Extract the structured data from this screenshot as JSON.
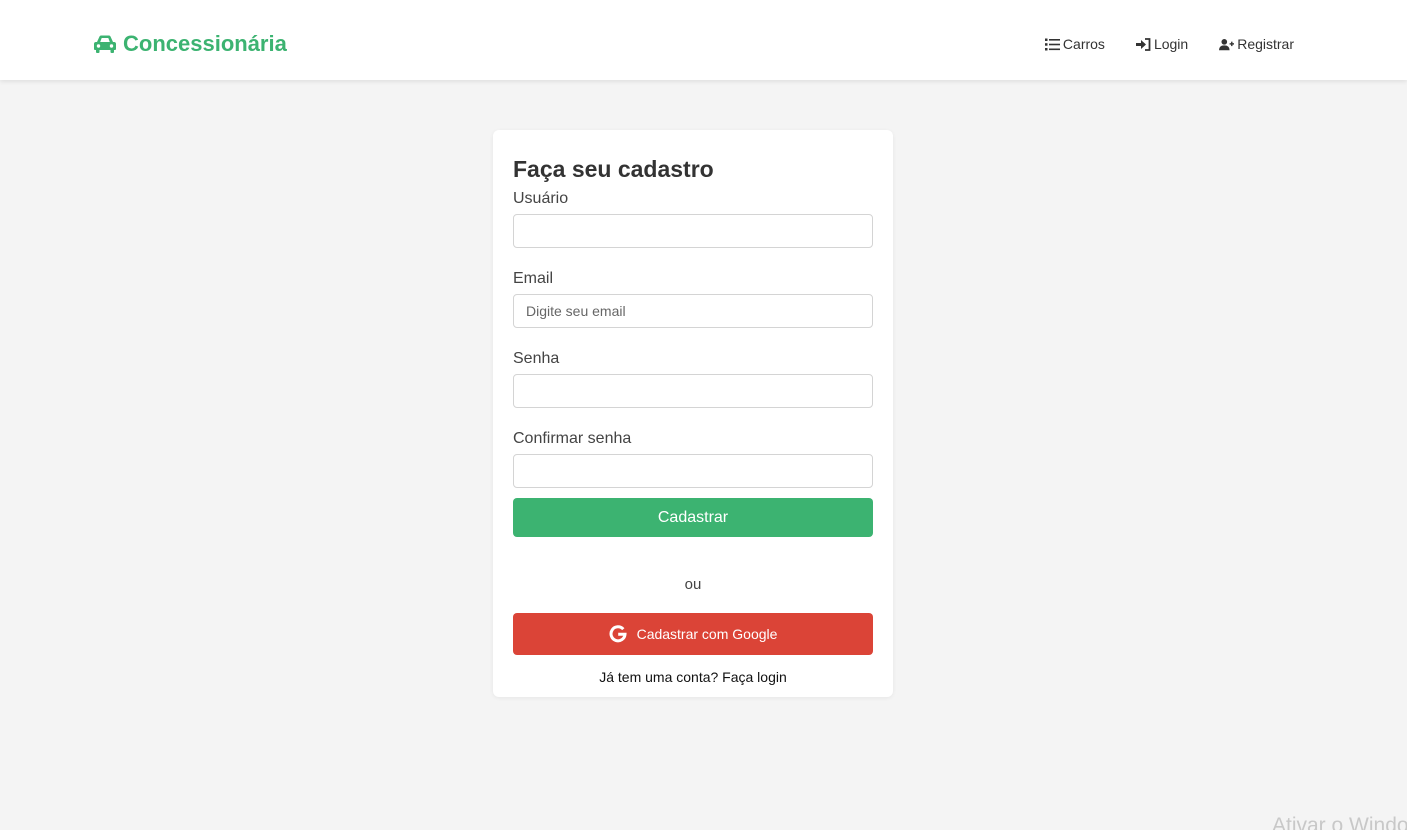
{
  "navbar": {
    "brand": "Concessionária",
    "brand_icon": "car-icon",
    "links": [
      {
        "label": "Carros",
        "icon": "list-icon"
      },
      {
        "label": "Login",
        "icon": "sign-in-icon"
      },
      {
        "label": "Registrar",
        "icon": "user-plus-icon"
      }
    ]
  },
  "form": {
    "title": "Faça seu cadastro",
    "username": {
      "label": "Usuário",
      "value": "",
      "placeholder": ""
    },
    "email": {
      "label": "Email",
      "value": "",
      "placeholder": "Digite seu email"
    },
    "password": {
      "label": "Senha",
      "value": "",
      "placeholder": ""
    },
    "confirm_password": {
      "label": "Confirmar senha",
      "value": "",
      "placeholder": ""
    },
    "submit_label": "Cadastrar",
    "divider": "ou",
    "google_label": "Cadastrar com Google",
    "google_icon": "google-icon",
    "login_prompt": "Já tem uma conta? Faça login"
  },
  "watermark": "Ativar o Windows",
  "colors": {
    "accent": "#3cb371",
    "google": "#db4437",
    "background": "#f4f4f4"
  }
}
